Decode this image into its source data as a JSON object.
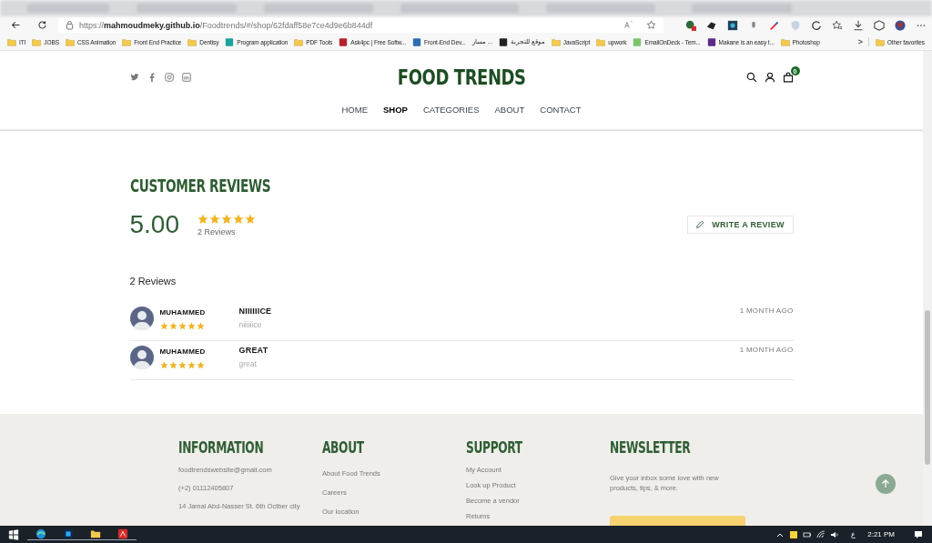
{
  "browser": {
    "url": "https://**mahmoudmeky.github.io**/Foodtrends/#/shop/62fdaff58e7ce4d9e6b844df",
    "bookmarks": [
      {
        "kind": "folder",
        "label": "ITI"
      },
      {
        "kind": "folder",
        "label": "JOBS"
      },
      {
        "kind": "folder",
        "label": "CSS Animation"
      },
      {
        "kind": "folder",
        "label": "Front End Practice"
      },
      {
        "kind": "folder",
        "label": "Dentisy"
      },
      {
        "kind": "site",
        "label": "Program application",
        "color": "#1aa39a"
      },
      {
        "kind": "folder",
        "label": "PDF Tools"
      },
      {
        "kind": "site",
        "label": "Ask4pc | Free Softw...",
        "color": "#b3202a"
      },
      {
        "kind": "site",
        "label": "Front-End Dev...",
        "color": "#2b6cb0"
      },
      {
        "kind": "text",
        "label": "مسار ..."
      },
      {
        "kind": "site",
        "label": "موقع للتجربة",
        "color": "#222222"
      },
      {
        "kind": "folder",
        "label": "JavaScript"
      },
      {
        "kind": "folder",
        "label": "upwork"
      },
      {
        "kind": "site",
        "label": "EmailOnDeck - Tem...",
        "color": "#7cc46b"
      },
      {
        "kind": "site",
        "label": "Makane is an easy t...",
        "color": "#5b2a86"
      },
      {
        "kind": "folder",
        "label": "Photoshop"
      }
    ],
    "more": ">",
    "other": "Other favorites"
  },
  "header": {
    "logo": "FOOD TRENDS",
    "cart_count": "0",
    "nav": [
      {
        "label": "HOME",
        "selected": false
      },
      {
        "label": "SHOP",
        "selected": true
      },
      {
        "label": "CATEGORIES",
        "selected": false
      },
      {
        "label": "ABOUT",
        "selected": false
      },
      {
        "label": "CONTACT",
        "selected": false
      }
    ]
  },
  "reviews": {
    "title": "CUSTOMER REVIEWS",
    "average": "5.00",
    "stars": 5,
    "count": "2 Reviews",
    "write_button": "WRITE A REVIEW",
    "list_heading": "2 Reviews",
    "items": [
      {
        "name": "MUHAMMED",
        "stars": 5,
        "title": "NIIIIIICE",
        "body": "niiiiiice",
        "time": "1 MONTH AGO"
      },
      {
        "name": "MUHAMMED",
        "stars": 5,
        "title": "GREAT",
        "body": "great",
        "time": "1 MONTH AGO"
      }
    ]
  },
  "footer": {
    "columns": [
      {
        "title": "INFORMATION",
        "items": [
          "foodtrendswebsite@gmail.com",
          "(+2) 01112405807",
          "14 Jamal Abd-Nasser St. 6th Octber city"
        ]
      },
      {
        "title": "ABOUT",
        "items": [
          "About Food Trends",
          "Careers",
          "Our location"
        ]
      },
      {
        "title": "SUPPORT",
        "items": [
          "My Account",
          "Look up Product",
          "Become a vendor",
          "Returns"
        ]
      },
      {
        "title": "NEWSLETTER",
        "text": "Give your inbox some love with new products, tips, & more."
      }
    ]
  },
  "taskbar": {
    "language": "ع",
    "time": "2:21 PM"
  }
}
